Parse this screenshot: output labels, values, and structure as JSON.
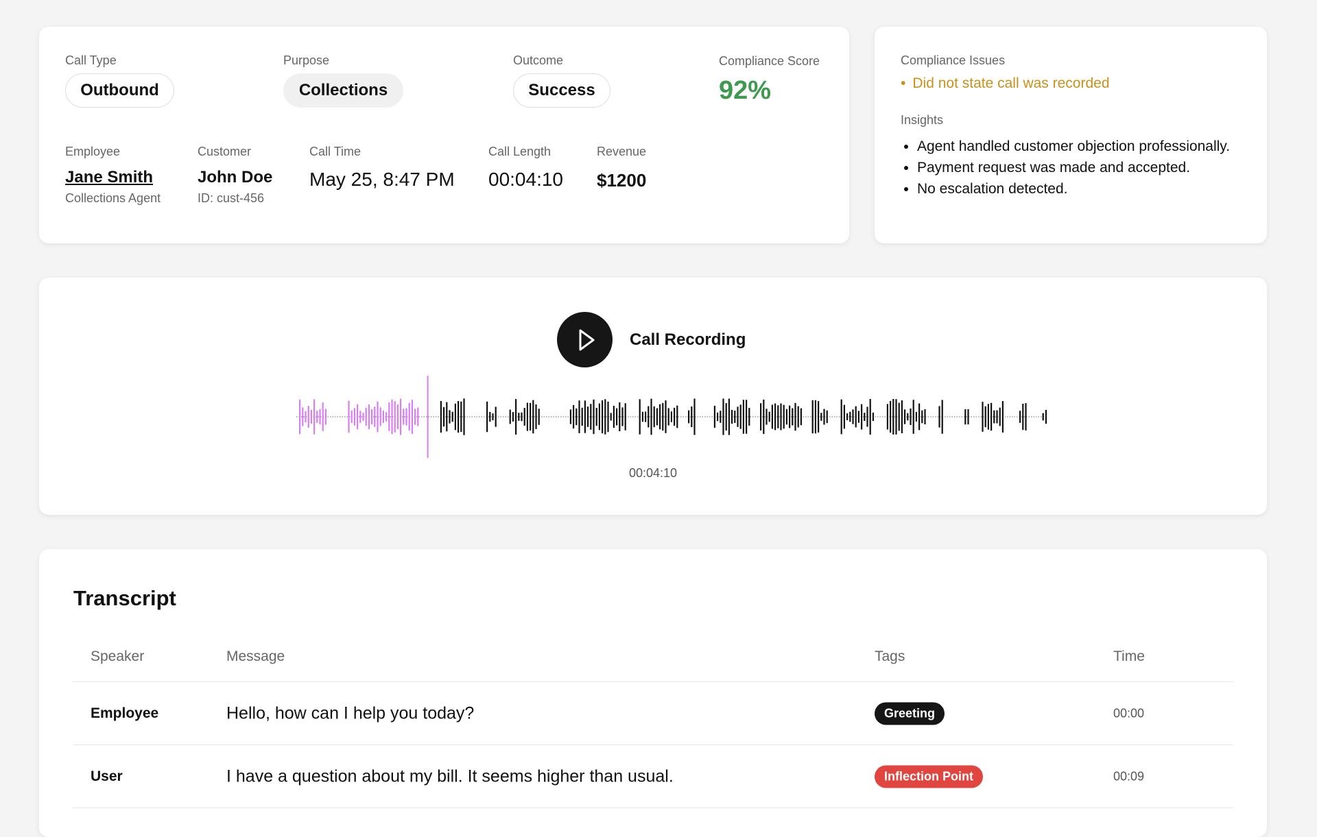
{
  "call_summary": {
    "call_type": {
      "label": "Call Type",
      "value": "Outbound"
    },
    "purpose": {
      "label": "Purpose",
      "value": "Collections"
    },
    "outcome": {
      "label": "Outcome",
      "value": "Success"
    },
    "compliance_score": {
      "label": "Compliance Score",
      "value": "92%",
      "color": "#3e9a4e"
    },
    "employee": {
      "label": "Employee",
      "name": "Jane Smith",
      "role": "Collections Agent"
    },
    "customer": {
      "label": "Customer",
      "name": "John Doe",
      "id": "ID: cust-456"
    },
    "call_time": {
      "label": "Call Time",
      "value": "May 25, 8:47 PM"
    },
    "call_length": {
      "label": "Call Length",
      "value": "00:04:10"
    },
    "revenue": {
      "label": "Revenue",
      "value": "$1200"
    }
  },
  "compliance": {
    "issues_label": "Compliance Issues",
    "issues": [
      "Did not state call was recorded"
    ],
    "issue_color": "#c8921a",
    "insights_label": "Insights",
    "insights": [
      "Agent handled customer objection professionally.",
      "Payment request was made and accepted.",
      "No escalation detected."
    ]
  },
  "recording": {
    "title": "Call Recording",
    "duration": "00:04:10",
    "play_icon": "play-icon",
    "played_fraction": 0.175,
    "played_color": "#d77ef0",
    "unplayed_color": "#111111"
  },
  "transcript": {
    "title": "Transcript",
    "columns": {
      "speaker": "Speaker",
      "message": "Message",
      "tags": "Tags",
      "time": "Time"
    },
    "rows": [
      {
        "speaker": "Employee",
        "message": "Hello, how can I help you today?",
        "tag": "Greeting",
        "tag_color": "#161616",
        "time": "00:00"
      },
      {
        "speaker": "User",
        "message": "I have a question about my bill. It seems higher than usual.",
        "tag": "Inflection Point",
        "tag_color": "#e0453f",
        "time": "00:09"
      }
    ]
  }
}
